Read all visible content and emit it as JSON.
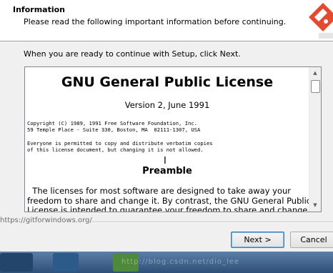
{
  "header": {
    "title": "Information",
    "subtitle": "Please read the following important information before continuing."
  },
  "instruction": "When you are ready to continue with Setup, click Next.",
  "license": {
    "title": "GNU General Public License",
    "version": "Version 2, June 1991",
    "copyright_lines": "Copyright (C) 1989, 1991 Free Software Foundation, Inc.\n59 Temple Place - Suite 330, Boston, MA  02111-1307, USA",
    "permission_lines": "Everyone is permitted to copy and distribute verbatim copies\nof this license document, but changing it is not allowed.",
    "preamble_heading": "Preamble",
    "preamble_text": "  The licenses for most software are designed to take away your\nfreedom to share and change it. By contrast, the GNU General Public\nLicense is intended to guarantee your freedom to share and change"
  },
  "footer": {
    "url": "https://gitforwindows.org/"
  },
  "buttons": {
    "next": "Next >",
    "cancel": "Cancel"
  },
  "taskbar": {
    "watermark": "http://blog.csdn.net/dio_lee"
  },
  "colors": {
    "logo_red": "#e64a2e",
    "window_bg": "#f0f0f0",
    "taskbar_blue": "#3f6594"
  },
  "icons": {
    "logo": "git-logo-icon",
    "scroll_up": "scroll-up-arrow-icon",
    "scroll_down": "scroll-down-arrow-icon",
    "cursor": "text-cursor-icon"
  }
}
